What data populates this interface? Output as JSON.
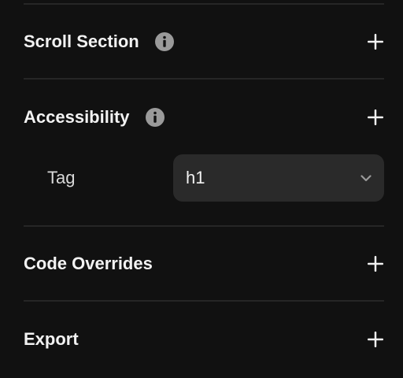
{
  "sections": {
    "scroll_section": {
      "title": "Scroll Section"
    },
    "accessibility": {
      "title": "Accessibility"
    },
    "code_overrides": {
      "title": "Code Overrides"
    },
    "export": {
      "title": "Export"
    }
  },
  "accessibility_tag": {
    "label": "Tag",
    "selected": "h1"
  },
  "colors": {
    "background": "#111111",
    "divider": "#262626",
    "select_bg": "#2a2a2a",
    "info_icon": "#9a9a9a",
    "text": "#f2f2f2"
  },
  "icons": {
    "info": "info-icon",
    "expand": "plus-icon",
    "dropdown": "chevron-down-icon"
  }
}
